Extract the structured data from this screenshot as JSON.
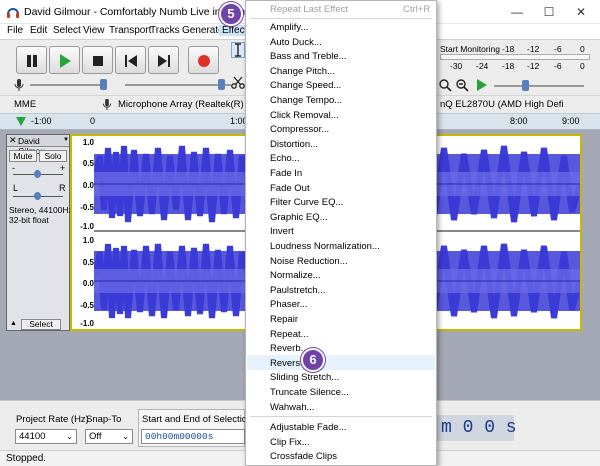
{
  "window": {
    "title": "David Gilmour - Comfortably Numb Live in Pompeii 201",
    "minimize": "—",
    "maximize": "☐",
    "close": "✕"
  },
  "menubar": [
    "File",
    "Edit",
    "Select",
    "View",
    "Transport",
    "Tracks",
    "Generate",
    "Effect"
  ],
  "annotations": {
    "step5": "5",
    "step6": "6"
  },
  "toolbar": {
    "start_monitoring": "Start Monitoring",
    "meter_ticks_top": [
      "-18",
      "-12",
      "-6",
      "0"
    ],
    "meter_ticks_bottom": [
      "-30",
      "-24",
      "-18",
      "-12",
      "-6",
      "0"
    ]
  },
  "devices": {
    "host": "MME",
    "mic": "Microphone Array (Realtek(R) Au",
    "output": "nQ EL2870U (AMD High Defi"
  },
  "timeline": {
    "ticks": [
      "-1:00",
      "0",
      "1:00",
      "8:00",
      "9:00"
    ]
  },
  "track": {
    "name": "David Gilmou",
    "mute": "Mute",
    "solo": "Solo",
    "gain_minus": "-",
    "gain_plus": "+",
    "pan_left": "L",
    "pan_right": "R",
    "info_line1": "Stereo, 44100Hz",
    "info_line2": "32-bit float",
    "select": "Select",
    "ruler": [
      "1.0",
      "0.5",
      "0.0",
      "-0.5",
      "-1.0"
    ]
  },
  "effect_menu": {
    "repeat_last": "Repeat Last Effect",
    "repeat_shortcut": "Ctrl+R",
    "items": [
      "Amplify...",
      "Auto Duck...",
      "Bass and Treble...",
      "Change Pitch...",
      "Change Speed...",
      "Change Tempo...",
      "Click Removal...",
      "Compressor...",
      "Distortion...",
      "Echo...",
      "Fade In",
      "Fade Out",
      "Filter Curve EQ...",
      "Graphic EQ...",
      "Invert",
      "Loudness Normalization...",
      "Noise Reduction...",
      "Normalize...",
      "Paulstretch...",
      "Phaser...",
      "Repair",
      "Repeat...",
      "Reverb...",
      "Reverse",
      "Sliding Stretch...",
      "Truncate Silence...",
      "Wahwah..."
    ],
    "items2": [
      "Adjustable Fade...",
      "Clip Fix...",
      "Crossfade Clips"
    ],
    "highlighted": "Reverse"
  },
  "selection_bar": {
    "project_rate_label": "Project Rate (Hz)",
    "project_rate_value": "44100",
    "snap_to_label": "Snap-To",
    "snap_to_value": "Off",
    "selection_label": "Start and End of Selection",
    "selection_value": "00h00m00000s",
    "time_display": "m 0 0 s"
  },
  "status": "Stopped.",
  "colors": {
    "waveform": "#3b3bd6",
    "selection_border": "#c8b800",
    "badge": "#6f43a8",
    "menu_highlight": "#e5f1fb"
  }
}
